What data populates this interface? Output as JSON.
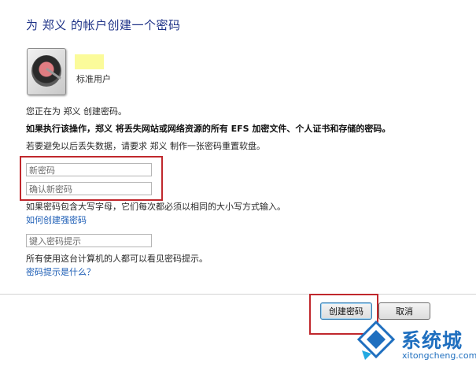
{
  "title": "为 郑义 的帐户创建一个密码",
  "account": {
    "type_label": "标准用户"
  },
  "messages": {
    "creating": "您正在为 郑义 创建密码。",
    "warning": "如果执行该操作，郑义 将丢失网站或网络资源的所有 EFS 加密文件、个人证书和存储的密码。",
    "advice": "若要避免以后丢失数据，请要求 郑义 制作一张密码重置软盘。"
  },
  "fields": {
    "new_password_placeholder": "新密码",
    "confirm_password_placeholder": "确认新密码",
    "case_note": "如果密码包含大写字母，它们每次都必须以相同的大小写方式输入。",
    "strong_password_link": "如何创建强密码",
    "hint_placeholder": "键入密码提示",
    "hint_note": "所有使用这台计算机的人都可以看见密码提示。",
    "hint_help_link": "密码提示是什么？"
  },
  "buttons": {
    "create": "创建密码",
    "cancel": "取消"
  },
  "watermark": {
    "name": "系统城",
    "url": "xitongcheng.com"
  },
  "colors": {
    "title": "#1e3287",
    "link": "#1b5cb5",
    "highlight_box": "#c0282d"
  }
}
